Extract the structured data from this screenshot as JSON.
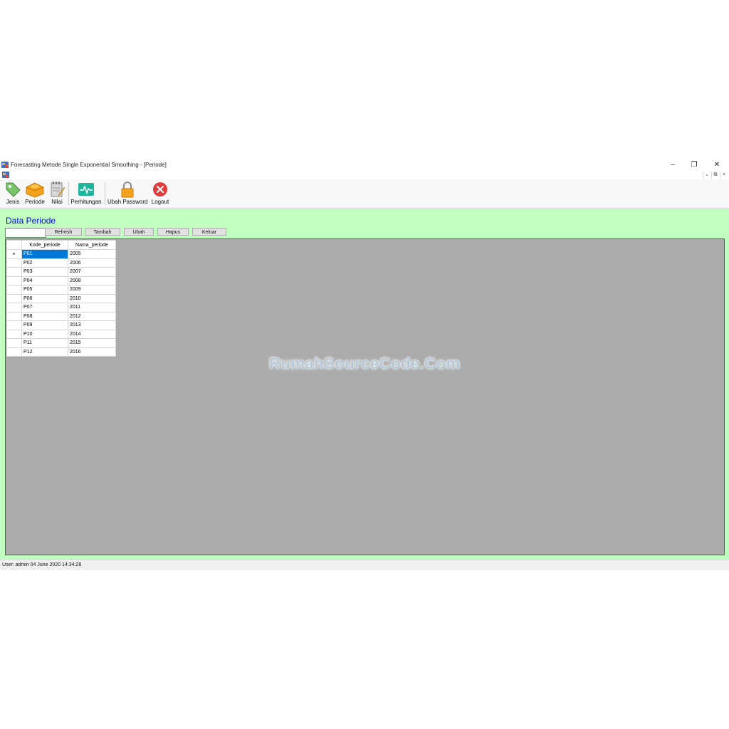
{
  "window": {
    "title": "Forecasting Metode Single Exponential Smoothing - [Periode]",
    "minimize": "–",
    "maximize": "❐",
    "close": "✕"
  },
  "mdi": {
    "minimize": "⌄",
    "restore": "⧉",
    "close": "×"
  },
  "toolbar": {
    "jenis": "Jenis",
    "periode": "Periode",
    "nilai": "Nilai",
    "perhitungan": "Perhitungan",
    "ubah_password": "Ubah Password",
    "logout": "Logout"
  },
  "form": {
    "title": "Data Periode",
    "search_value": "",
    "refresh": "Refresh",
    "tambah": "Tambah",
    "ubah": "Ubah",
    "hapus": "Hapus",
    "keluar": "Keluar"
  },
  "grid": {
    "columns": [
      "Kode_periode",
      "Nama_periode"
    ],
    "rows": [
      [
        "P01",
        "2005"
      ],
      [
        "P02",
        "2006"
      ],
      [
        "P03",
        "2007"
      ],
      [
        "P04",
        "2008"
      ],
      [
        "P05",
        "2009"
      ],
      [
        "P06",
        "2010"
      ],
      [
        "P07",
        "2011"
      ],
      [
        "P08",
        "2012"
      ],
      [
        "P09",
        "2013"
      ],
      [
        "P10",
        "2014"
      ],
      [
        "P11",
        "2015"
      ],
      [
        "P12",
        "2016"
      ]
    ],
    "current_row_marker": "▸"
  },
  "watermark": "RumahSourceCode.Com",
  "status": {
    "text": "User: admin  04 June 2020 14:34:28"
  }
}
